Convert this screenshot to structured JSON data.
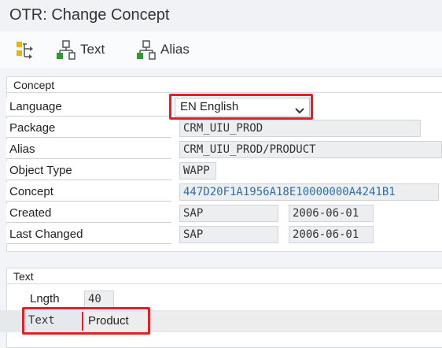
{
  "window": {
    "title": "OTR: Change Concept"
  },
  "toolbar": {
    "items": [
      {
        "icon": "tree-structure-icon",
        "label": ""
      },
      {
        "icon": "hierarchy-icon",
        "label": "Text"
      },
      {
        "icon": "hierarchy-icon",
        "label": "Alias"
      }
    ]
  },
  "concept": {
    "section_title": "Concept",
    "language": {
      "label": "Language",
      "value": "EN English"
    },
    "package": {
      "label": "Package",
      "value": "CRM_UIU_PROD"
    },
    "alias": {
      "label": "Alias",
      "value": "CRM_UIU_PROD/PRODUCT"
    },
    "object_type": {
      "label": "Object Type",
      "value": "WAPP"
    },
    "concept_id": {
      "label": "Concept",
      "value": "447D20F1A1956A18E10000000A4241B1"
    },
    "created": {
      "label": "Created",
      "user": "SAP",
      "date": "2006-06-01"
    },
    "last_changed": {
      "label": "Last Changed",
      "user": "SAP",
      "date": "2006-06-01"
    }
  },
  "text_section": {
    "section_title": "Text",
    "length": {
      "label": "Lngth",
      "value": "40"
    },
    "text": {
      "label": "Text",
      "value": "Product"
    }
  },
  "colors": {
    "highlight": "#e31e24",
    "link": "#2f6dab"
  }
}
